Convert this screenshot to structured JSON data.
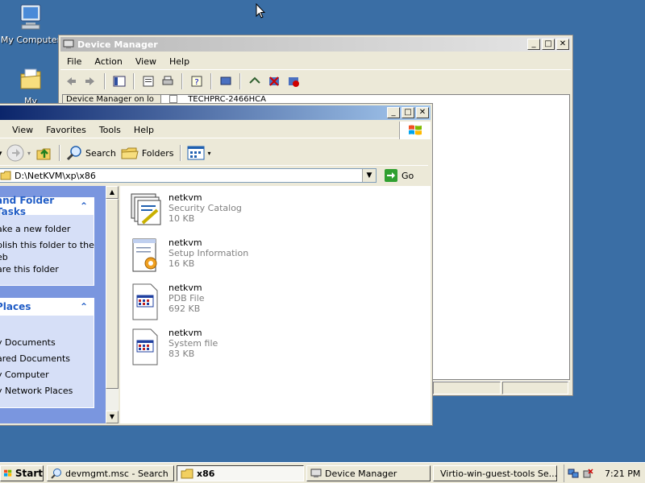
{
  "desktop": {
    "icons": [
      {
        "label": "My Computer"
      },
      {
        "label": "My Documents"
      }
    ]
  },
  "device_manager": {
    "title": "Device Manager",
    "menu": [
      "File",
      "Action",
      "View",
      "Help"
    ],
    "tree_tab": "Device Manager on lo",
    "tree_node": "TECHPRC-2466HCA"
  },
  "explorer": {
    "menu": [
      "View",
      "Favorites",
      "Tools",
      "Help"
    ],
    "toolbar": {
      "search_label": "Search",
      "folders_label": "Folders"
    },
    "address": {
      "value": "D:\\NetKVM\\xp\\x86",
      "go_label": "Go"
    },
    "task_panels": [
      {
        "title": "and Folder Tasks",
        "links": [
          "ake a new folder",
          "blish this folder to the",
          "eb",
          "are this folder"
        ]
      },
      {
        "title": "Places",
        "links": [
          "",
          "y Documents",
          "ared Documents",
          "y Computer",
          "y Network Places"
        ]
      }
    ],
    "files": [
      {
        "name": "netkvm",
        "type": "Security Catalog",
        "size": "10 KB",
        "icon": "security-catalog-icon"
      },
      {
        "name": "netkvm",
        "type": "Setup Information",
        "size": "16 KB",
        "icon": "setup-information-icon"
      },
      {
        "name": "netkvm",
        "type": "PDB File",
        "size": "692 KB",
        "icon": "pdb-file-icon"
      },
      {
        "name": "netkvm",
        "type": "System file",
        "size": "83 KB",
        "icon": "system-file-icon"
      }
    ]
  },
  "taskbar": {
    "start_label": "Start",
    "items": [
      {
        "label": "devmgmt.msc - Search",
        "active": false
      },
      {
        "label": "x86",
        "active": true
      },
      {
        "label": "Device Manager",
        "active": false
      },
      {
        "label": "Virtio-win-guest-tools Se...",
        "active": false
      }
    ],
    "clock": "7:21 PM"
  },
  "colors": {
    "desktop": "#3a6ea5",
    "active_title_start": "#0a246a",
    "active_title_end": "#a6caf0",
    "window_face": "#ece9d8",
    "task_pane": "#7a96df",
    "task_link_blue": "#215dc6"
  }
}
